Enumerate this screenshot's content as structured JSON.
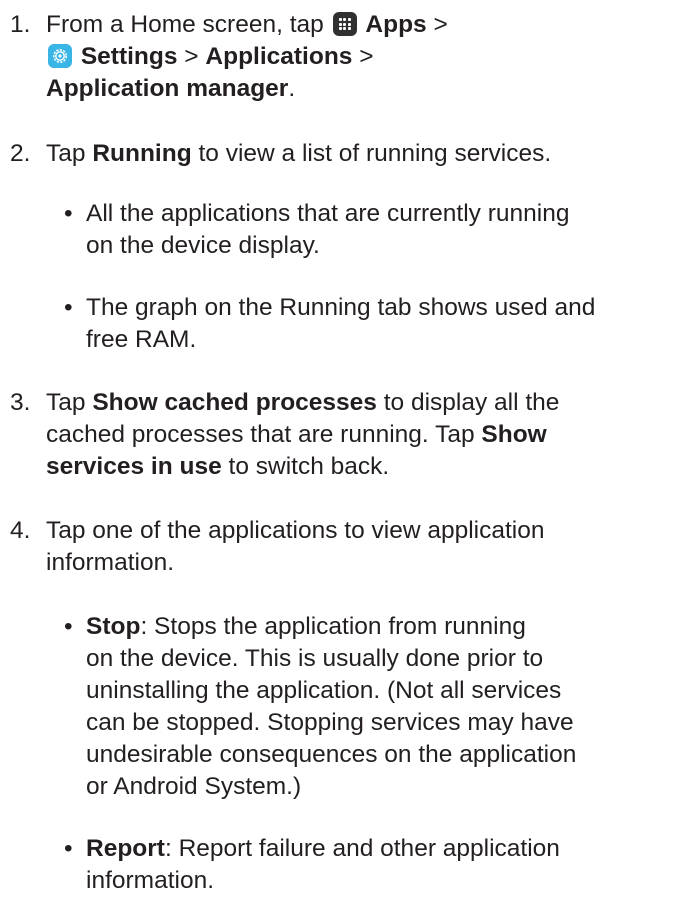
{
  "step1": {
    "num": "1.",
    "t1": "From a Home screen, tap",
    "apps": "Apps",
    "sep1": ">",
    "settings": "Settings",
    "sep2": ">",
    "applications": "Applications",
    "sep3": ">",
    "app_manager": "Application manager",
    "end": "."
  },
  "step2": {
    "num": "2.",
    "t1": "Tap",
    "running": "Running",
    "t2": "to view a list of running services.",
    "bullets": [
      [
        "All the applications that are currently running",
        "on the device display."
      ],
      [
        "The graph on the Running tab shows used and",
        "free RAM."
      ]
    ]
  },
  "step3": {
    "num": "3.",
    "t1": "Tap",
    "show_cached": "Show cached processes",
    "t2": "to display all the",
    "t3": "cached processes that are running. Tap",
    "show_services_a": "Show",
    "show_services_b": "services in use",
    "t4": "to switch back."
  },
  "step4": {
    "num": "4.",
    "l1": "Tap one of the applications to view application",
    "l2": "information.",
    "stop": {
      "label": "Stop",
      "l1": ": Stops the application from running",
      "l2": "on the device. This is usually done prior to",
      "l3": "uninstalling the application. (Not all services",
      "l4": "can be stopped. Stopping services may have",
      "l5": "undesirable consequences on the application",
      "l6": "or Android System.)"
    },
    "report": {
      "label": "Report",
      "l1": ": Report failure and other application",
      "l2": "information."
    }
  },
  "bullet_glyph": "•",
  "icons": {
    "apps": "apps-grid-icon",
    "settings": "settings-gear-icon"
  },
  "colors": {
    "text": "#231f20",
    "apps_icon": "#303030",
    "settings_icon": "#39b5e6"
  }
}
